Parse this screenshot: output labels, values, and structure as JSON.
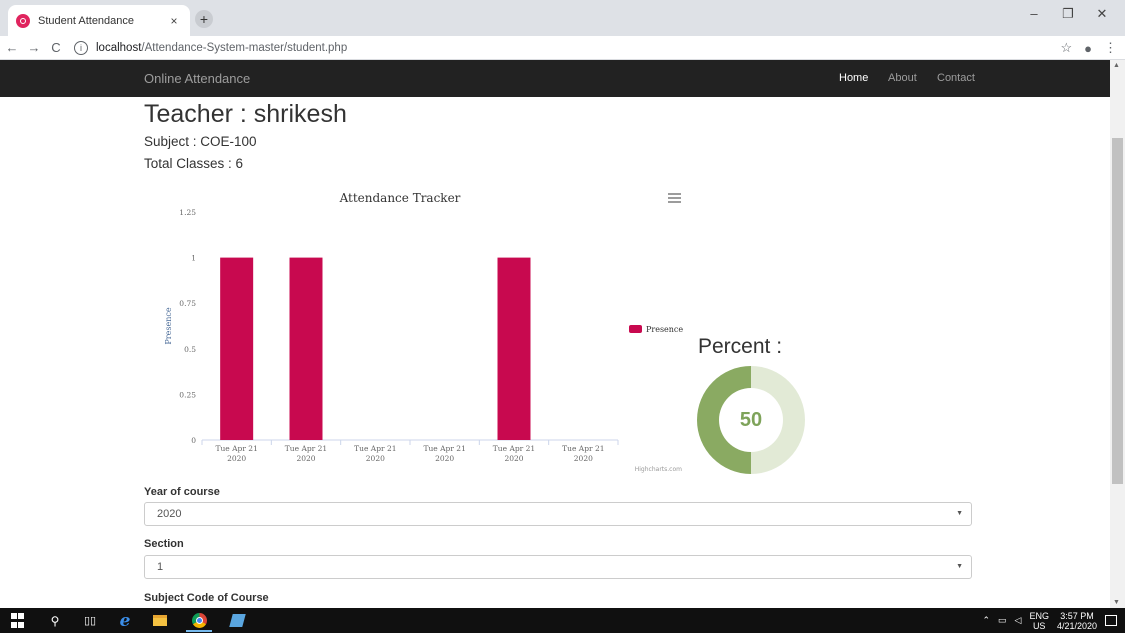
{
  "browser": {
    "tab_title": "Student Attendance",
    "tab_close": "×",
    "new_tab": "+",
    "url_host": "localhost",
    "url_path": "/Attendance-System-master/student.php",
    "window_minimize": "–",
    "window_maximize": "❐",
    "window_close": "✕"
  },
  "navbar": {
    "brand": "Online Attendance",
    "links": [
      {
        "label": "Home",
        "active": true
      },
      {
        "label": "About",
        "active": false
      },
      {
        "label": "Contact",
        "active": false
      }
    ]
  },
  "page": {
    "teacher": "Teacher : shrikesh",
    "subject": "Subject : COE-100",
    "total_classes": "Total Classes : 6",
    "percent_label": "Percent :",
    "percent_value": "50"
  },
  "chart_data": {
    "type": "bar",
    "title": "Attendance Tracker",
    "ylabel": "Presence",
    "xlabel": "",
    "categories": [
      "Tue Apr 21 2020",
      "Tue Apr 21 2020",
      "Tue Apr 21 2020",
      "Tue Apr 21 2020",
      "Tue Apr 21 2020",
      "Tue Apr 21 2020"
    ],
    "series": [
      {
        "name": "Presence",
        "values": [
          1,
          1,
          0,
          0,
          1,
          0
        ]
      }
    ],
    "ylim": [
      0,
      1.25
    ],
    "yticks": [
      "0",
      "0.25",
      "0.5",
      "0.75",
      "1",
      "1.25"
    ],
    "legend": "right",
    "credits": "Highcharts.com",
    "menu_icon": "hamburger-icon",
    "bar_color": "#c8094f"
  },
  "donut": {
    "value_percent": 50,
    "filled_color": "#8aaa62",
    "remaining_color": "#e2ead6"
  },
  "form": {
    "year_label": "Year of course",
    "year_value": "2020",
    "section_label": "Section",
    "section_value": "1",
    "subject_code_label": "Subject Code of Course"
  },
  "taskbar": {
    "lang_top": "ENG",
    "lang_bottom": "US",
    "time": "3:57 PM",
    "date": "4/21/2020"
  }
}
